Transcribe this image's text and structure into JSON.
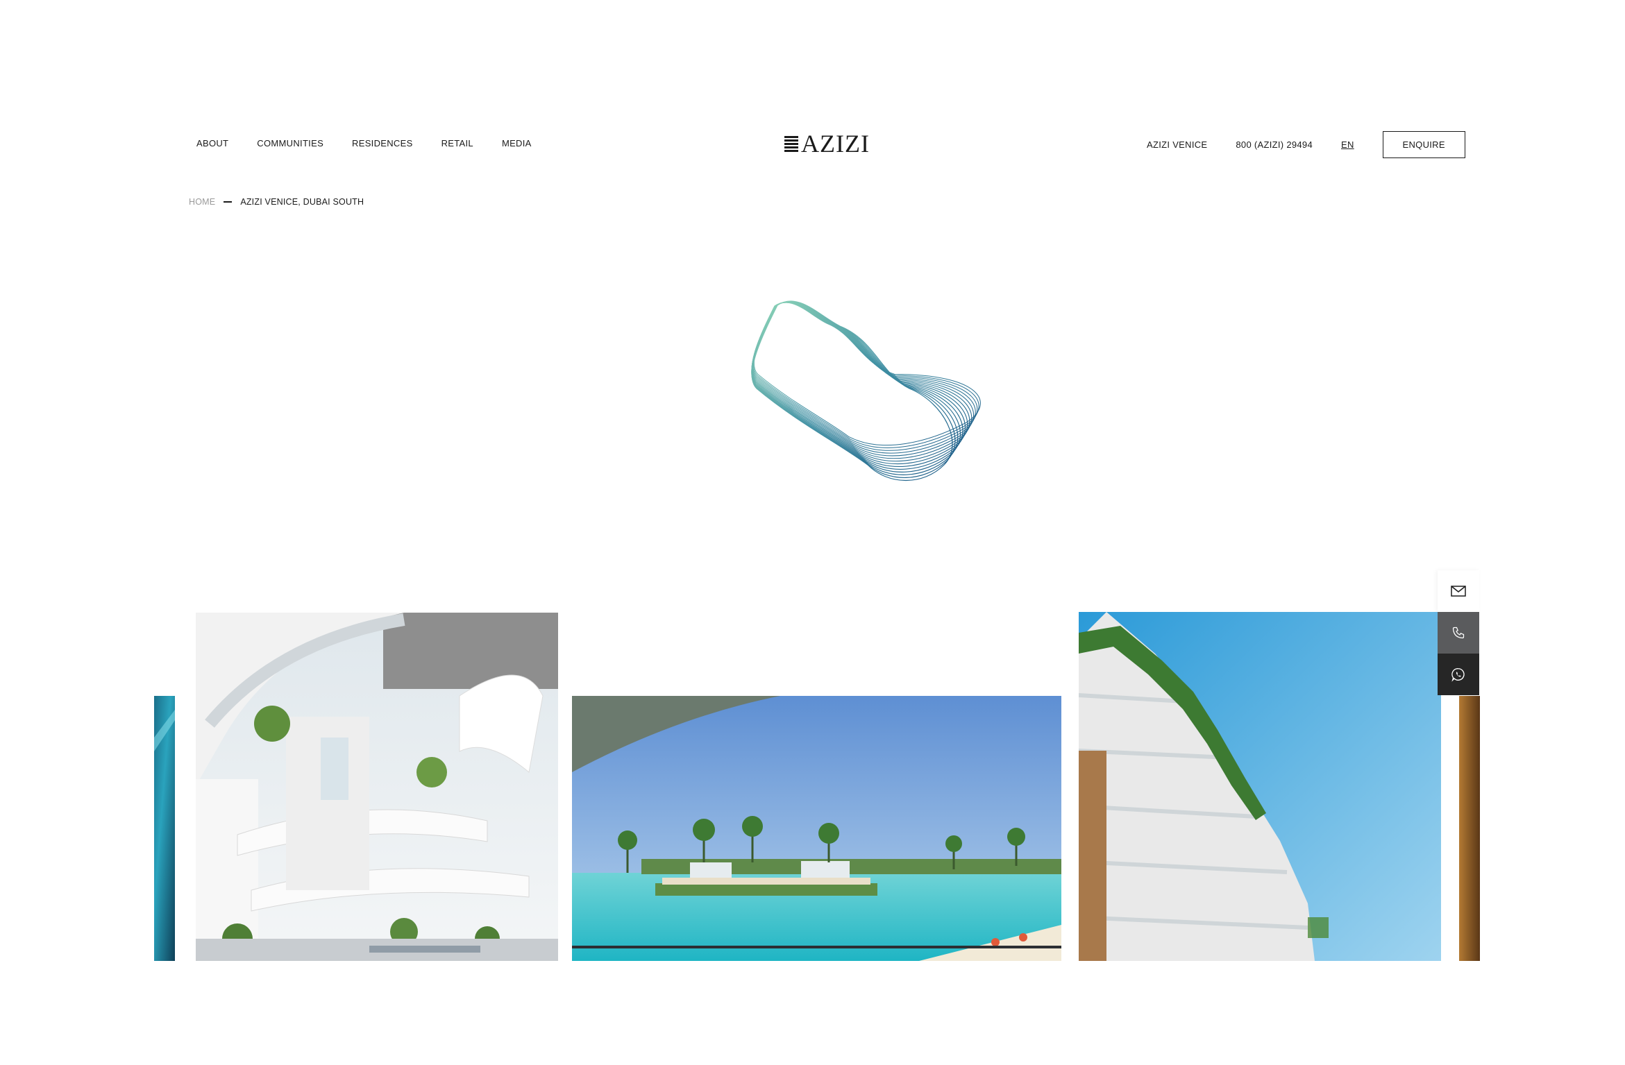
{
  "header": {
    "nav_left": [
      "ABOUT",
      "COMMUNITIES",
      "RESIDENCES",
      "RETAIL",
      "MEDIA"
    ],
    "logo_text": "AZIZI",
    "project_link": "AZIZI VENICE",
    "phone": "800 (AZIZI) 29494",
    "language": "EN",
    "enquire_label": "ENQUIRE"
  },
  "breadcrumb": {
    "home": "HOME",
    "current": "AZIZI VENICE, DUBAI SOUTH"
  },
  "gallery": {
    "images": [
      {
        "name": "pool-edge-partial-image"
      },
      {
        "name": "atrium-interior-image"
      },
      {
        "name": "lagoon-beach-image"
      },
      {
        "name": "terraced-tower-image"
      },
      {
        "name": "wood-partial-image"
      }
    ]
  },
  "float_buttons": {
    "icons": [
      "mail-icon",
      "phone-icon",
      "whatsapp-icon"
    ],
    "colors": {
      "mail": "#ffffff",
      "call": "#5a5b5d",
      "whatsapp": "#262626"
    }
  },
  "colors": {
    "text": "#1a1a1a",
    "muted": "#9a9a9a",
    "wave_start": "#7fcfb3",
    "wave_end": "#1e5f8a"
  }
}
